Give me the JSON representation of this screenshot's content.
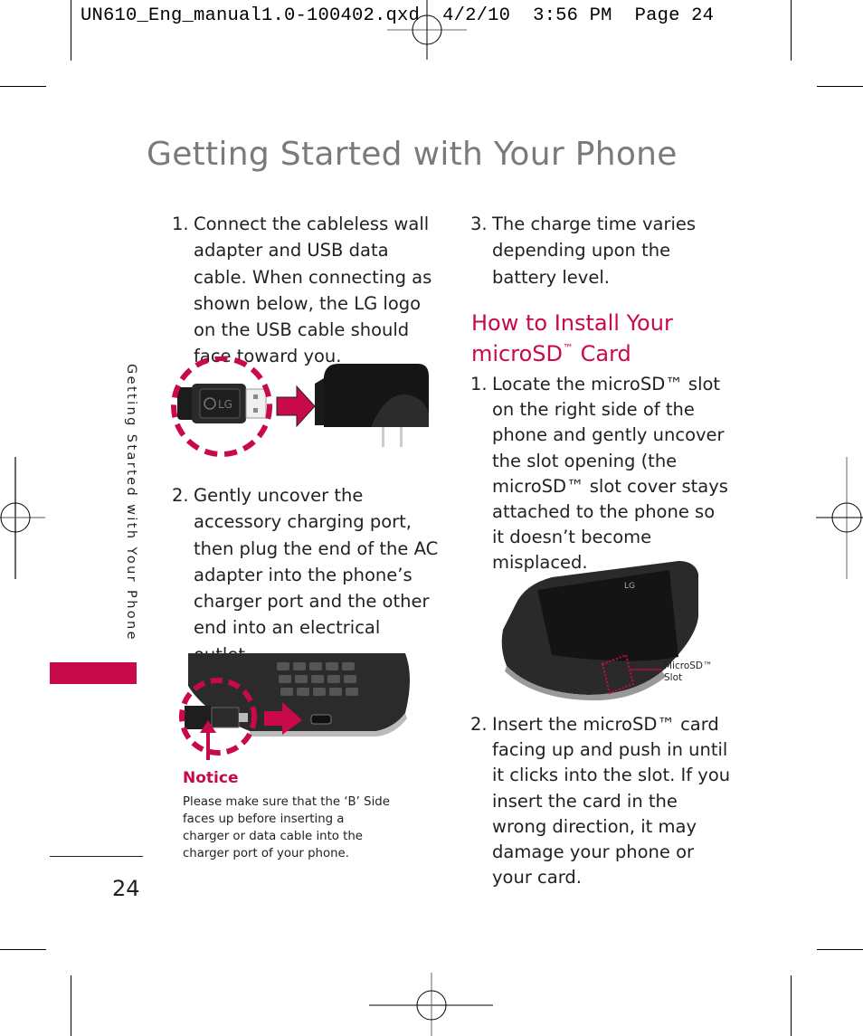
{
  "slug": {
    "filename": "UN610_Eng_manual1.0-100402.qxd",
    "date": "4/2/10",
    "time": "3:56 PM",
    "page": "Page 24"
  },
  "title": "Getting Started with Your Phone",
  "side_label": "Getting Started with Your Phone",
  "page_number": "24",
  "left_column": {
    "steps": [
      {
        "num": "1.",
        "text": "Connect the cableless wall adapter and USB data cable. When connecting as shown below, the LG logo on the USB cable should face toward you."
      },
      {
        "num": "2.",
        "text": "Gently uncover the accessory charging port, then plug the end of the AC adapter into the phone’s charger port and the other end into an electrical outlet."
      }
    ],
    "notice": {
      "title": "Notice",
      "text": "Please make sure that the ‘B’ Side faces up before inserting a charger or data cable into the charger port of your phone."
    }
  },
  "right_column": {
    "charge_step": {
      "num": "3.",
      "text": "The charge time varies depending upon the battery level."
    },
    "section_heading": {
      "line1": "How to Install Your",
      "line2_prefix": "microSD",
      "tm": "™",
      "line2_suffix": " Card"
    },
    "steps": [
      {
        "num": "1.",
        "text": "Locate the microSD™ slot on the right side of the phone and gently uncover the slot opening (the microSD™ slot cover stays attached to the phone so it doesn’t become misplaced."
      },
      {
        "num": "2.",
        "text": "Insert the microSD™ card facing up and push in until it clicks into the slot. If you insert the card in the wrong direction, it may damage your phone or your card."
      }
    ],
    "callout": {
      "line1": "MicroSD™",
      "line2": "Slot"
    }
  },
  "images": {
    "usb_plug": "usb-cable-with-lg-logo",
    "wall_adapter": "wall-adapter",
    "phone_port": "phone-charger-port",
    "phone_closed": "phone-with-microsd-slot"
  },
  "colors": {
    "accent": "#c8094a",
    "title_gray": "#7a7a7a",
    "text": "#231f20"
  }
}
